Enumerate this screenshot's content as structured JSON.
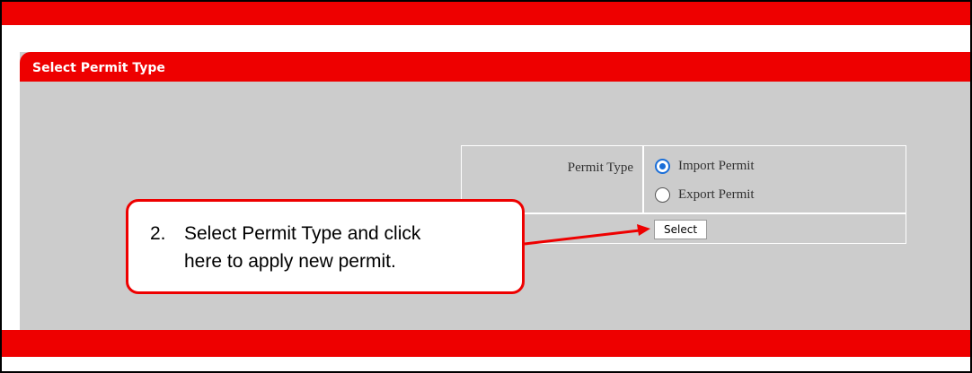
{
  "panel": {
    "title": "Select Permit Type"
  },
  "form": {
    "permit_type_label": "Permit Type",
    "options": [
      {
        "label": "Import Permit",
        "checked": true
      },
      {
        "label": "Export Permit",
        "checked": false
      }
    ],
    "select_button": "Select"
  },
  "callout": {
    "number": "2.",
    "line1": "Select Permit Type and click",
    "line2": "here to apply new permit."
  },
  "colors": {
    "brand_red": "#ee0000",
    "panel_grey": "#cccccc",
    "radio_blue": "#1a6ed8"
  }
}
